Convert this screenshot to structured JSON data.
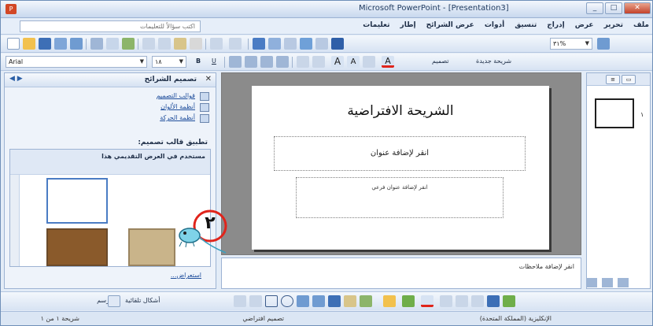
{
  "window": {
    "title": "Microsoft PowerPoint - [Presentation3]"
  },
  "menubar": {
    "items": [
      "ملف",
      "تحرير",
      "عرض",
      "إدراج",
      "تنسيق",
      "أدوات",
      "عرض الشرائح",
      "إطار",
      "تعليمات"
    ],
    "help_placeholder": "اكتب سؤالاً للتعليمات"
  },
  "toolbar": {
    "zoom": "٣١%",
    "font_name": "Arial",
    "font_size": "١٨",
    "bold": "B",
    "underline": "U",
    "new_slide": "شريحة جديدة",
    "design": "تصميم"
  },
  "task_pane": {
    "title": "تصميم الشرائح",
    "links": [
      "قوالب التصميم",
      "أنظمة الألوان",
      "أنظمة الحركة"
    ],
    "apply_label": "تطبيق قالب تصميم:",
    "used_label": "مستخدم في العرض التقديمي هذا",
    "browse": "استعراض..."
  },
  "slide": {
    "title": "الشريحة الافتراضية",
    "title_placeholder": "انقر لإضافة عنوان",
    "subtitle_placeholder": "انقر لإضافة عنوان فرعي"
  },
  "slides_pane": {
    "slide_number": "١"
  },
  "notes": {
    "placeholder": "انقر لإضافة ملاحظات"
  },
  "drawing": {
    "draw": "رسم",
    "autoshapes": "أشكال تلقائية"
  },
  "status": {
    "slide_count": "شريحة ١ من ١",
    "design_name": "تصميم افتراضي",
    "language": "الإنكليزية (المملكة المتحدة)"
  },
  "annotation": {
    "number": "٢"
  },
  "colors": {
    "accent_red": "#e0241b",
    "mouse_body": "#7fd3e8"
  }
}
